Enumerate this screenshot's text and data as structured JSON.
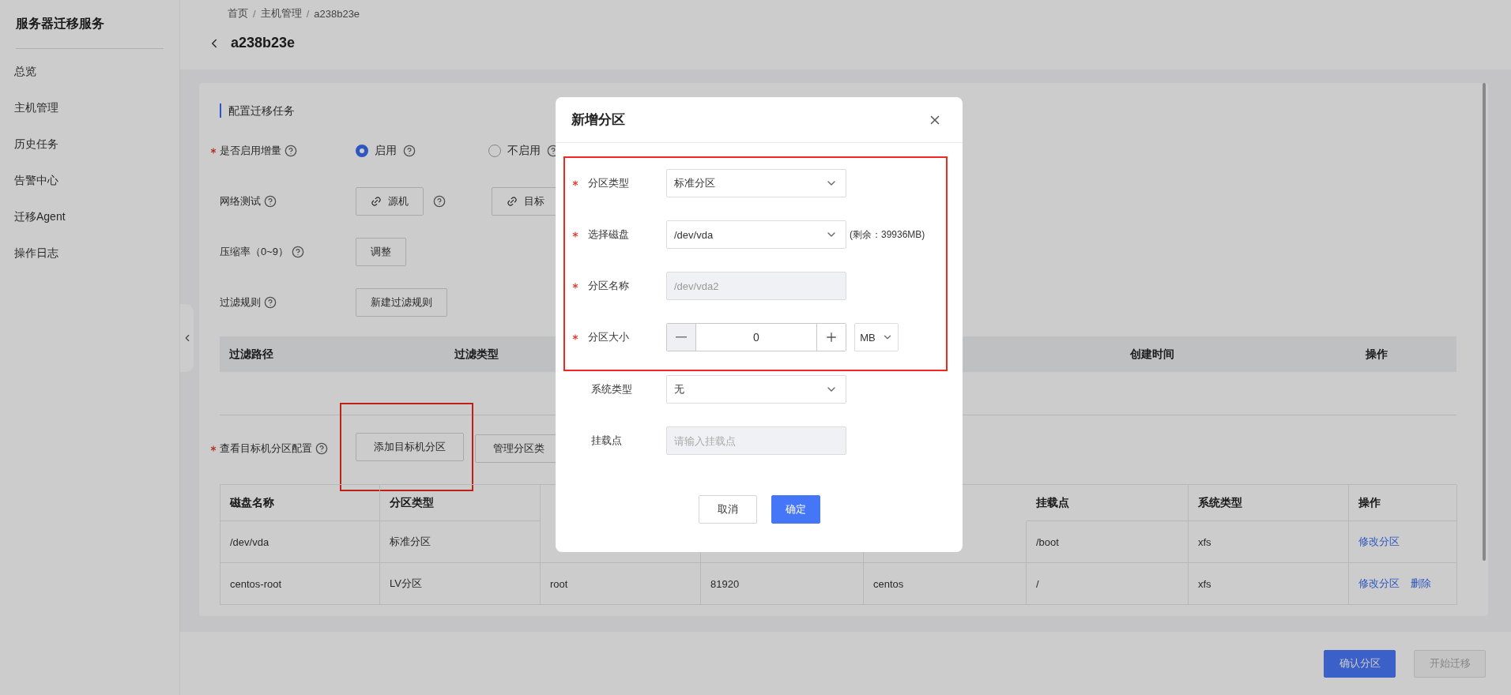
{
  "sidebar": {
    "title": "服务器迁移服务",
    "items": [
      {
        "label": "总览"
      },
      {
        "label": "主机管理"
      },
      {
        "label": "历史任务"
      },
      {
        "label": "告警中心"
      },
      {
        "label": "迁移Agent"
      },
      {
        "label": "操作日志"
      }
    ]
  },
  "header": {
    "breadcrumb": [
      {
        "kind": "link",
        "text": "首页"
      },
      {
        "kind": "separator",
        "text": "/"
      },
      {
        "kind": "link",
        "text": "主机管理"
      },
      {
        "kind": "separator",
        "text": "/"
      },
      {
        "kind": "link",
        "text": "a238b23e"
      }
    ],
    "title": "a238b23e"
  },
  "section_title": "配置迁移任务",
  "form_rows": [
    {
      "kind": "radio",
      "label": "是否启用增量",
      "required": true,
      "options": [
        {
          "label": "启用",
          "selected": true
        },
        {
          "label": "不启用",
          "selected": false
        }
      ]
    },
    {
      "kind": "buttons",
      "label": "网络测试",
      "required": false,
      "buttons": [
        {
          "label": "源机",
          "link": true
        },
        {
          "label": "目标",
          "link": true
        }
      ]
    },
    {
      "kind": "buttons",
      "label": "压缩率（0~9）",
      "required": false,
      "buttons": [
        {
          "label": "调整",
          "link": false
        }
      ]
    },
    {
      "kind": "buttons",
      "label": "过滤规则",
      "required": false,
      "buttons": [
        {
          "label": "新建过滤规则",
          "link": false
        }
      ]
    }
  ],
  "filter_table": {
    "columns": [
      "过滤路径",
      "过滤类型",
      "创建时间",
      "操作"
    ]
  },
  "partition_row": {
    "label": "查看目标机分区配置",
    "required": true,
    "buttons": [
      {
        "label": "添加目标机分区",
        "highlighted": true
      },
      {
        "label": "管理分区类",
        "highlighted": false
      }
    ]
  },
  "partition_table": {
    "columns": [
      "磁盘名称",
      "分区类型",
      null,
      null,
      null,
      "挂载点",
      "系统类型",
      "操作"
    ],
    "rows": [
      {
        "cells": [
          "/dev/vda",
          "标准分区",
          null,
          null,
          null,
          "/boot",
          "xfs"
        ],
        "actions": [
          "修改分区"
        ]
      },
      {
        "cells": [
          "centos-root",
          "LV分区",
          "root",
          "81920",
          "centos",
          "/",
          "xfs"
        ],
        "actions": [
          "修改分区",
          "删除"
        ]
      }
    ]
  },
  "footer": {
    "buttons": [
      {
        "label": "确认分区",
        "disabled": false
      },
      {
        "label": "开始迁移",
        "disabled": true
      }
    ]
  },
  "dialog": {
    "title": "新增分区",
    "fields": [
      {
        "kind": "select",
        "label": "分区类型",
        "required": true,
        "highlighted": true,
        "value": "标准分区"
      },
      {
        "kind": "select",
        "label": "选择磁盘",
        "required": true,
        "highlighted": true,
        "value": "/dev/vda",
        "note": "(剩余：39936MB)"
      },
      {
        "kind": "input",
        "label": "分区名称",
        "required": true,
        "highlighted": true,
        "value": "/dev/vda2",
        "disabled": true
      },
      {
        "kind": "stepper",
        "label": "分区大小",
        "required": true,
        "highlighted": true,
        "value": "0",
        "unit": "MB"
      },
      {
        "kind": "select",
        "label": "系统类型",
        "required": false,
        "highlighted": false,
        "value": "无"
      },
      {
        "kind": "input",
        "label": "挂载点",
        "required": false,
        "highlighted": false,
        "placeholder": "请输入挂载点",
        "disabled": true
      }
    ],
    "buttons": [
      {
        "label": "取消",
        "primary": false
      },
      {
        "label": "确定",
        "primary": true
      }
    ]
  }
}
